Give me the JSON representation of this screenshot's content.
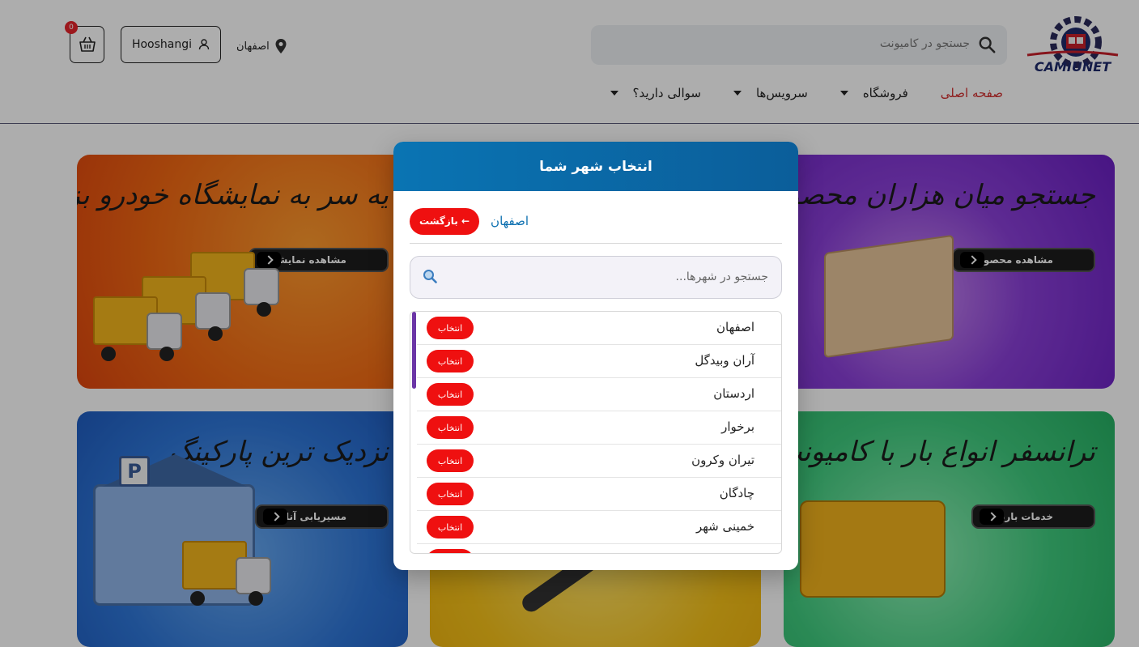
{
  "header": {
    "logo_text": "CAMIUNET",
    "search_placeholder": "جستجو در کامیونت",
    "location": "اصفهان",
    "user_name": "Hooshangi",
    "cart_count": "0"
  },
  "nav": {
    "items": [
      {
        "label": "صفحه اصلی",
        "active": true,
        "dropdown": false
      },
      {
        "label": "فروشگاه",
        "active": false,
        "dropdown": true
      },
      {
        "label": "سرویس‌ها",
        "active": false,
        "dropdown": true
      },
      {
        "label": "سوالی دارید؟",
        "active": false,
        "dropdown": true
      }
    ]
  },
  "banners": {
    "purple": {
      "title": "جستجو میان هزاران محصول",
      "button": "مشاهده محصولات"
    },
    "orange": {
      "title": "یه سر به نمایشگاه خودرو بزن",
      "button": "مشاهده نمایشگاه"
    },
    "blue": {
      "title": "نزدیک ترین پارکینگ",
      "button": "مسیریابی آنلاین"
    },
    "green": {
      "title": "ترانسفر انواع بار با کامیونت",
      "button": "خدمات باربری"
    }
  },
  "modal": {
    "title": "انتخاب شهر شما",
    "back_label": "← بازگشت",
    "current_province": "اصفهان",
    "search_placeholder": "جستجو در شهرها...",
    "select_label": "انتخاب",
    "cities": [
      "اصفهان",
      "آران وبیدگل",
      "اردستان",
      "برخوار",
      "تیران وکرون",
      "چادگان",
      "خمینی شهر"
    ]
  },
  "colors": {
    "accent_red": "#ef1010",
    "modal_header_blue": "#0a74b3",
    "nav_active": "#d12d2d",
    "scroll_purple": "#6b35a6"
  }
}
